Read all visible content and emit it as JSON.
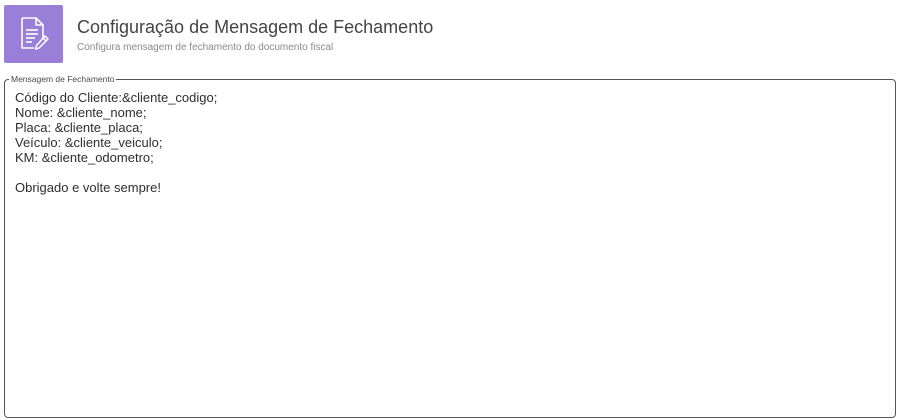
{
  "header": {
    "icon": "document-edit-icon",
    "accent_color": "#9a7fd8",
    "title": "Configuração de Mensagem de Fechamento",
    "subtitle": "Configura mensagem de fechamento do documento fiscal"
  },
  "message_box": {
    "legend": "Mensagem de Fechamento",
    "value": "Código do Cliente:&cliente_codigo;\nNome: &cliente_nome;\nPlaca: &cliente_placa;\nVeículo: &cliente_veiculo;\nKM: &cliente_odometro;\n\nObrigado e volte sempre!"
  }
}
